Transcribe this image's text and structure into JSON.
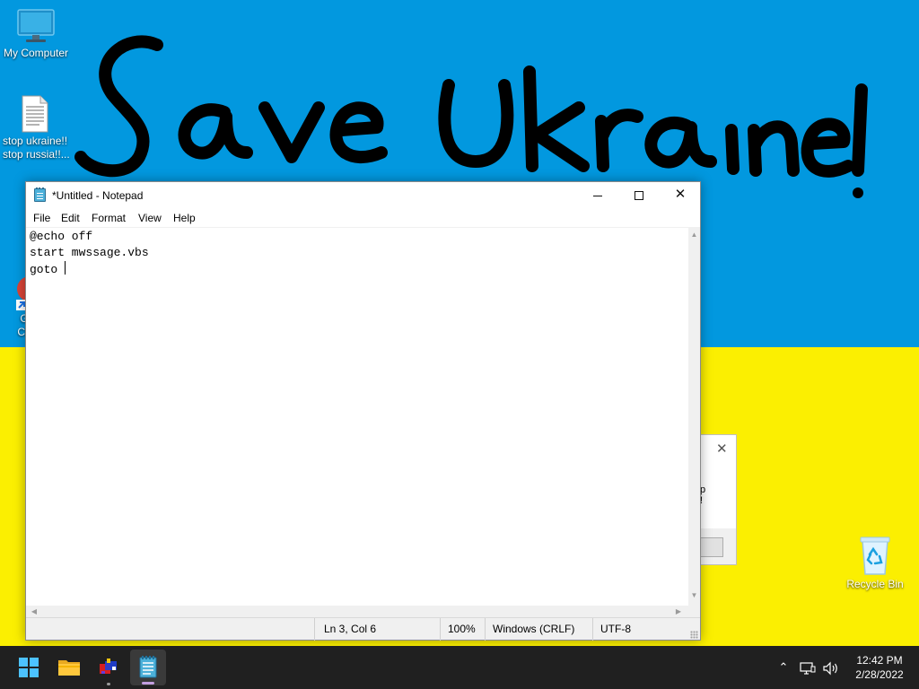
{
  "desktop": {
    "wallpaper_text": "Save Ukraine!",
    "colors": {
      "sky_blue": "#0298df",
      "field_yellow": "#fbef01"
    },
    "icons": [
      {
        "label": "My Computer",
        "icon": "monitor-icon"
      },
      {
        "label_line1": "stop ukraine!!",
        "label_line2": "stop russia!!...",
        "icon": "text-file-icon"
      },
      {
        "label_line1": "G",
        "label_line2": "Ch",
        "icon": "chrome-shortcut-icon"
      },
      {
        "label": "Recycle Bin",
        "icon": "recycle-bin-icon"
      }
    ]
  },
  "background_dialog": {
    "fragment_line1": "p",
    "fragment_line2": "!"
  },
  "notepad": {
    "title": "*Untitled - Notepad",
    "menu": [
      "File",
      "Edit",
      "Format",
      "View",
      "Help"
    ],
    "content_lines": [
      "@echo off",
      "start mwssage.vbs",
      "goto "
    ],
    "status": {
      "position": "Ln 3, Col 6",
      "zoom": "100%",
      "line_ending": "Windows (CRLF)",
      "encoding": "UTF-8"
    }
  },
  "taskbar": {
    "apps": [
      "start-icon",
      "file-explorer-icon",
      "paint-icon",
      "notepad-icon"
    ],
    "active_app": "notepad-icon",
    "accent_color": "#4cc2ff",
    "time": "12:42 PM",
    "date": "2/28/2022"
  }
}
